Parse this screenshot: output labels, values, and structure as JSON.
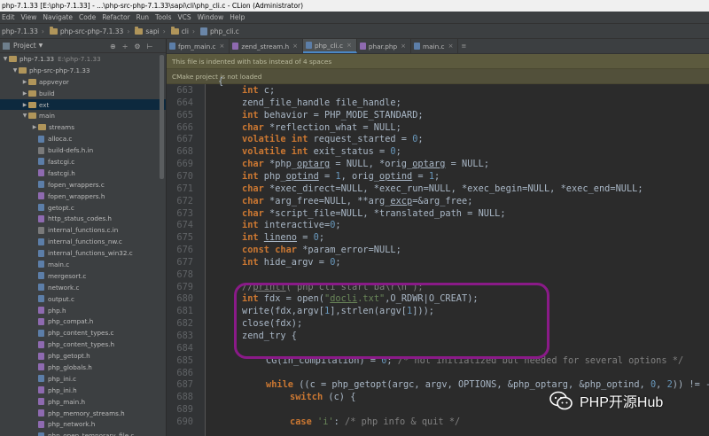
{
  "window": {
    "title": "php-7.1.33 [E:\\php-7.1.33] - ...\\php-src-php-7.1.33\\sapi\\cli\\php_cli.c - CLion (Administrator)"
  },
  "menu": [
    "Edit",
    "View",
    "Navigate",
    "Code",
    "Refactor",
    "Run",
    "Tools",
    "VCS",
    "Window",
    "Help"
  ],
  "breadcrumb": [
    "php-7.1.33",
    "php-src-php-7.1.33",
    "sapi",
    "cli",
    "php_cli.c"
  ],
  "project_panel": {
    "title": "Project",
    "tree": [
      {
        "label": "php-7.1.33",
        "extra": "E:\\php-7.1.33",
        "type": "folder",
        "open": true
      },
      {
        "label": "php-src-php-7.1.33",
        "type": "folder",
        "open": true
      },
      {
        "label": "appveyor",
        "type": "folder"
      },
      {
        "label": "build",
        "type": "folder"
      },
      {
        "label": "ext",
        "type": "folder",
        "selected": true
      },
      {
        "label": "main",
        "type": "folder",
        "open": true
      },
      {
        "label": "streams",
        "type": "folder"
      },
      {
        "label": "alloca.c",
        "type": "c"
      },
      {
        "label": "build-defs.h.in",
        "type": "in"
      },
      {
        "label": "fastcgi.c",
        "type": "c"
      },
      {
        "label": "fastcgi.h",
        "type": "h"
      },
      {
        "label": "fopen_wrappers.c",
        "type": "c"
      },
      {
        "label": "fopen_wrappers.h",
        "type": "h"
      },
      {
        "label": "getopt.c",
        "type": "c"
      },
      {
        "label": "http_status_codes.h",
        "type": "h"
      },
      {
        "label": "internal_functions.c.in",
        "type": "in"
      },
      {
        "label": "internal_functions_nw.c",
        "type": "c"
      },
      {
        "label": "internal_functions_win32.c",
        "type": "c"
      },
      {
        "label": "main.c",
        "type": "c"
      },
      {
        "label": "mergesort.c",
        "type": "c"
      },
      {
        "label": "network.c",
        "type": "c"
      },
      {
        "label": "output.c",
        "type": "c"
      },
      {
        "label": "php.h",
        "type": "h"
      },
      {
        "label": "php_compat.h",
        "type": "h"
      },
      {
        "label": "php_content_types.c",
        "type": "c"
      },
      {
        "label": "php_content_types.h",
        "type": "h"
      },
      {
        "label": "php_getopt.h",
        "type": "h"
      },
      {
        "label": "php_globals.h",
        "type": "h"
      },
      {
        "label": "php_ini.c",
        "type": "c"
      },
      {
        "label": "php_ini.h",
        "type": "h"
      },
      {
        "label": "php_main.h",
        "type": "h"
      },
      {
        "label": "php_memory_streams.h",
        "type": "h"
      },
      {
        "label": "php_network.h",
        "type": "h"
      },
      {
        "label": "php_open_temporary_file.c",
        "type": "c"
      }
    ]
  },
  "tabs": [
    {
      "label": "fpm_main.c",
      "active": false
    },
    {
      "label": "zend_stream.h",
      "active": false
    },
    {
      "label": "php_cli.c",
      "active": true
    },
    {
      "label": "phar.php",
      "active": false
    },
    {
      "label": "main.c",
      "active": false
    }
  ],
  "notices": [
    "This file is indented with tabs instead of 4 spaces",
    "CMake project is not loaded"
  ],
  "code": {
    "line_numbers": [
      "663",
      "664",
      "665",
      "666",
      "667",
      "668",
      "669",
      "670",
      "671",
      "672",
      "673",
      "674",
      "675",
      "676",
      "677",
      "678",
      "679",
      "680",
      "681",
      "682",
      "683",
      "684",
      "685",
      "686",
      "687",
      "688",
      "689",
      "690"
    ]
  },
  "watermark": {
    "text": "PHP开源Hub"
  },
  "colors": {
    "annotation": "#8a1a88",
    "keyword": "#cc7832",
    "string": "#6a8759",
    "number": "#6897bb",
    "comment": "#808080"
  }
}
